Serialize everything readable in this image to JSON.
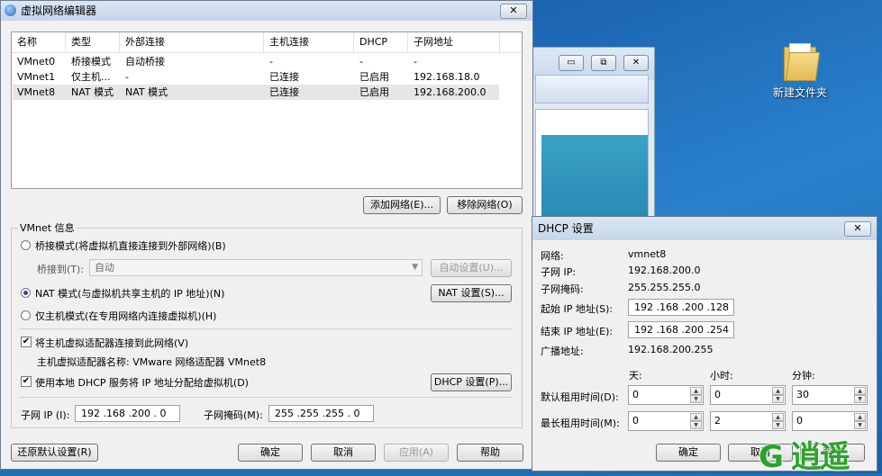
{
  "desktop": {
    "folder_label": "新建文件夹"
  },
  "bg_window": {
    "ctl_min": "▭",
    "ctl_restore": "⧉",
    "ctl_close": "✕"
  },
  "main": {
    "title": "虚拟网络编辑器",
    "close": "✕",
    "columns": [
      "名称",
      "类型",
      "外部连接",
      "主机连接",
      "DHCP",
      "子网地址"
    ],
    "rows": [
      [
        "VMnet0",
        "桥接模式",
        "自动桥接",
        "-",
        "-",
        "-"
      ],
      [
        "VMnet1",
        "仅主机...",
        "-",
        "已连接",
        "已启用",
        "192.168.18.0"
      ],
      [
        "VMnet8",
        "NAT 模式",
        "NAT 模式",
        "已连接",
        "已启用",
        "192.168.200.0"
      ]
    ],
    "add_network": "添加网络(E)...",
    "remove_network": "移除网络(O)",
    "group_title": "VMnet 信息",
    "bridge_mode": "桥接模式(将虚拟机直接连接到外部网络)(B)",
    "bridge_to_label": "桥接到(T):",
    "bridge_to_value": "自动",
    "auto_settings": "自动设置(U)...",
    "nat_mode": "NAT 模式(与虚拟机共享主机的 IP 地址)(N)",
    "nat_settings": "NAT 设置(S)...",
    "host_only": "仅主机模式(在专用网络内连接虚拟机)(H)",
    "connect_adapter": "将主机虚拟适配器连接到此网络(V)",
    "adapter_name_label": "主机虚拟适配器名称: VMware 网络适配器 VMnet8",
    "use_dhcp": "使用本地 DHCP 服务将 IP 地址分配给虚拟机(D)",
    "dhcp_settings": "DHCP 设置(P)...",
    "subnet_ip_label": "子网 IP (I):",
    "subnet_ip_value": "192 .168 .200 . 0",
    "subnet_mask_label": "子网掩码(M):",
    "subnet_mask_value": "255 .255 .255 . 0",
    "restore_defaults": "还原默认设置(R)",
    "ok": "确定",
    "cancel": "取消",
    "apply": "应用(A)",
    "help": "帮助"
  },
  "dhcp": {
    "title": "DHCP 设置",
    "close": "✕",
    "network_label": "网络:",
    "network_value": "vmnet8",
    "subnet_ip_label": "子网 IP:",
    "subnet_ip_value": "192.168.200.0",
    "subnet_mask_label": "子网掩码:",
    "subnet_mask_value": "255.255.255.0",
    "start_ip_label": "起始 IP 地址(S):",
    "start_ip_value": "192 .168 .200 .128",
    "end_ip_label": "结束 IP 地址(E):",
    "end_ip_value": "192 .168 .200 .254",
    "broadcast_label": "广播地址:",
    "broadcast_value": "192.168.200.255",
    "col_days": "天:",
    "col_hours": "小时:",
    "col_minutes": "分钟:",
    "default_lease_label": "默认租用时间(D):",
    "default_lease": [
      "0",
      "0",
      "30"
    ],
    "max_lease_label": "最长租用时间(M):",
    "max_lease": [
      "0",
      "2",
      "0"
    ],
    "ok": "确定",
    "cancel": "取消",
    "help": "帮助"
  },
  "watermark": "G 逍遥"
}
